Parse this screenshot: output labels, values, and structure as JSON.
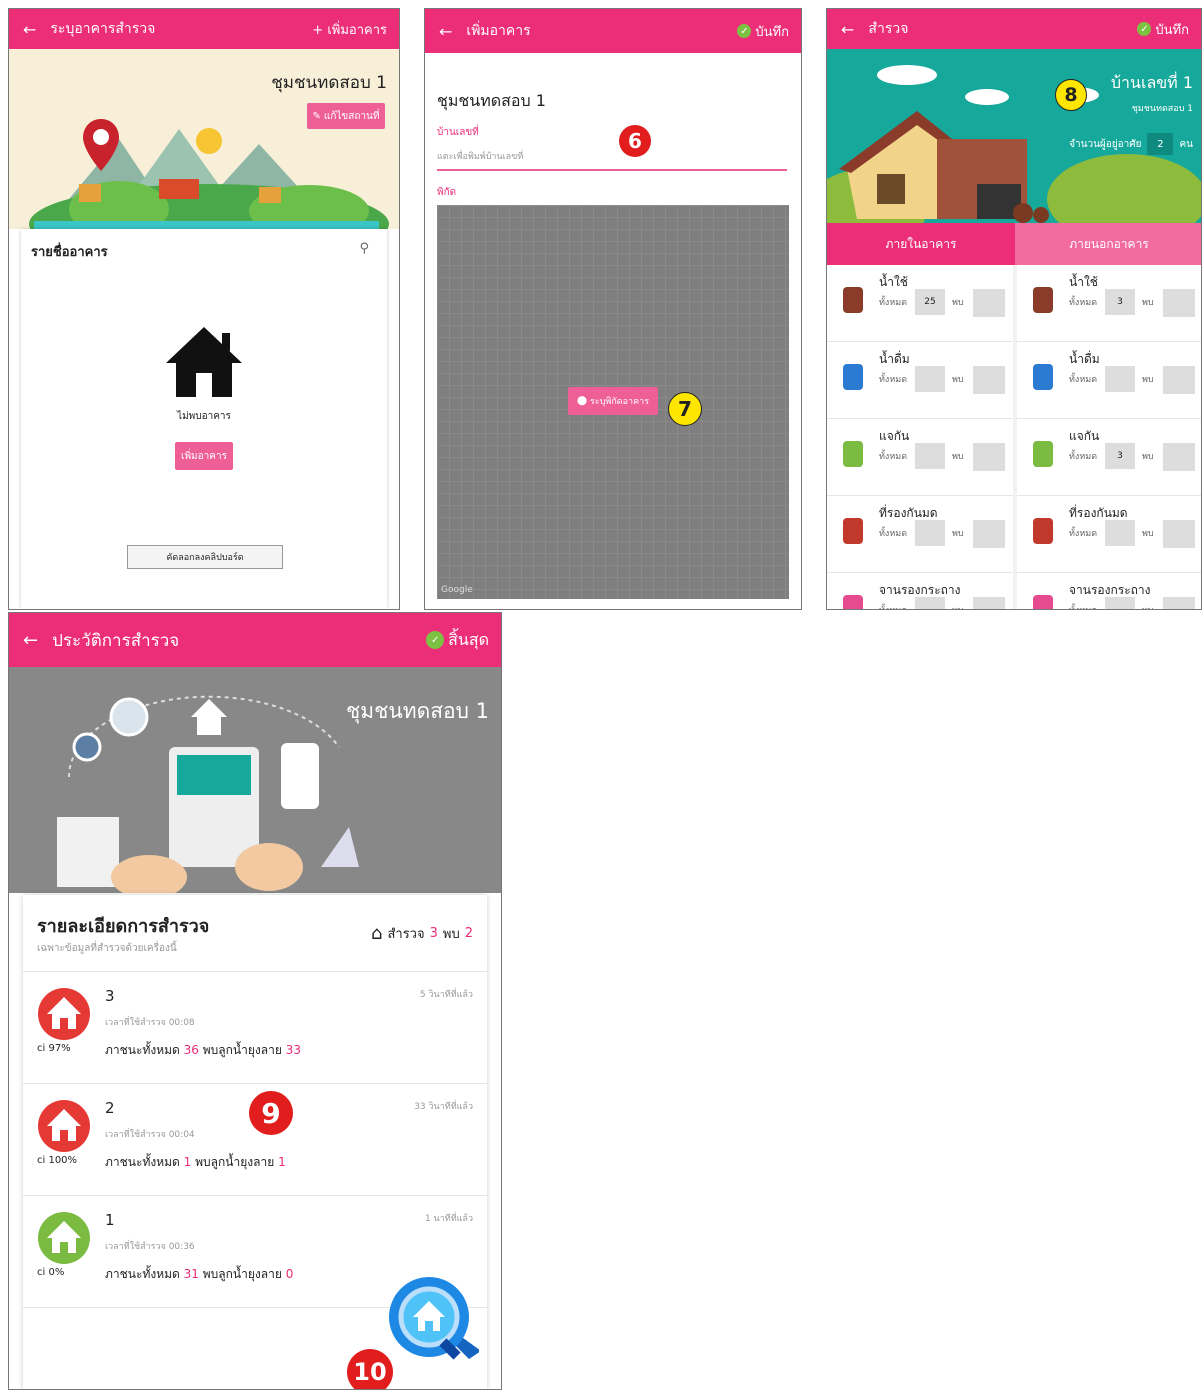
{
  "screen1": {
    "title": "ระบุอาคารสำรวจ",
    "add_label": "+ เพิ่มอาคาร",
    "community": "ชุมชนทดสอบ 1",
    "edit_label": "แก้ไขสถานที่",
    "list_title": "รายชื่ออาคาร",
    "empty_text": "ไม่พบอาคาร",
    "add_btn": "เพิ่มอาคาร",
    "copy_btn": "คัดลอกลงคลิปบอร์ด"
  },
  "screen2": {
    "title": "เพิ่มอาคาร",
    "save_label": "บันทึก",
    "community": "ชุมชนทดสอบ 1",
    "house_label": "บ้านเลขที่",
    "house_placeholder": "แตะเพื่อพิมพ์บ้านเลขที่",
    "coord_label": "พิกัด",
    "locate_btn": "ระบุพิกัดอาคาร",
    "map_logo": "Google",
    "badge6": "6",
    "badge7": "7"
  },
  "screen3": {
    "title": "สำรวจ",
    "save_label": "บันทึก",
    "house": "บ้านเลขที่ 1",
    "community": "ชุมชนทดสอบ 1",
    "residents_label": "จำนวนผู้อยู่อาศัย",
    "residents_value": "2",
    "residents_unit": "คน",
    "badge8": "8",
    "tab_inside": "ภายในอาคาร",
    "tab_outside": "ภายนอกอาคาร",
    "total_label": "ทั้งหมด",
    "found_label": "พบ",
    "rows": [
      {
        "name": "น้ำใช้",
        "icon": "jar-icon",
        "inside_total": "25",
        "outside_total": "3"
      },
      {
        "name": "น้ำดื่ม",
        "icon": "bottle-icon",
        "inside_total": "",
        "outside_total": ""
      },
      {
        "name": "แจกัน",
        "icon": "vase-icon",
        "inside_total": "",
        "outside_total": "3"
      },
      {
        "name": "ที่รองกันมด",
        "icon": "ant-tray-icon",
        "inside_total": "",
        "outside_total": ""
      },
      {
        "name": "จานรองกระถาง",
        "icon": "flower-pot-icon",
        "inside_total": "",
        "outside_total": ""
      }
    ]
  },
  "screen4": {
    "title": "ประวัติการสำรวจ",
    "end_label": "สิ้นสุด",
    "community": "ชุมชนทดสอบ 1",
    "detail_title": "รายละเอียดการสำรวจ",
    "detail_sub": "เฉพาะข้อมูลที่สำรวจด้วยเครื่องนี้",
    "survey_label": "สำรวจ",
    "survey_count": "3",
    "found_label": "พบ",
    "found_count": "2",
    "badge9": "9",
    "badge10": "10",
    "items": [
      {
        "num": "3",
        "ago": "5 วินาทีที่แล้ว",
        "time": "เวลาที่ใช้สำรวจ 00:08",
        "ci": "ci 97%",
        "total_label": "ภาชนะทั้งหมด",
        "total": "36",
        "larva_label": "พบลูกน้ำยุงลาย",
        "larva": "33",
        "color": "#e53935"
      },
      {
        "num": "2",
        "ago": "33 วินาทีที่แล้ว",
        "time": "เวลาที่ใช้สำรวจ 00:04",
        "ci": "ci 100%",
        "total_label": "ภาชนะทั้งหมด",
        "total": "1",
        "larva_label": "พบลูกน้ำยุงลาย",
        "larva": "1",
        "color": "#e53935"
      },
      {
        "num": "1",
        "ago": "1 นาทีที่แล้ว",
        "time": "เวลาที่ใช้สำรวจ 00:36",
        "ci": "ci 0%",
        "total_label": "ภาชนะทั้งหมด",
        "total": "31",
        "larva_label": "พบลูกน้ำยุงลาย",
        "larva": "0",
        "color": "#7cbb42"
      }
    ]
  },
  "colors": {
    "primary": "#ec2d78",
    "accent_pink": "#ee5e97",
    "red": "#e53935",
    "green": "#7cbb42",
    "teal": "#16a99b"
  }
}
